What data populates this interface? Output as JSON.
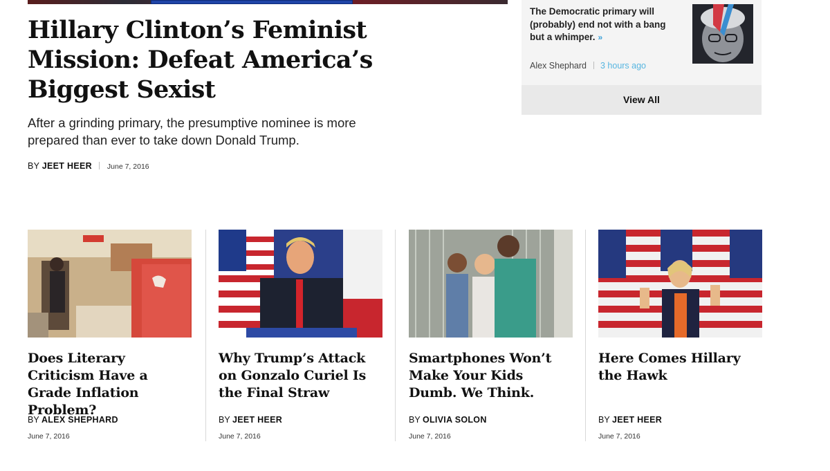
{
  "lead": {
    "headline": "Hillary Clinton’s Feminist Mission: Defeat America’s Biggest Sexist",
    "dek": "After a grinding primary, the presumptive nominee is more prepared than ever to take down Donald Trump.",
    "by": "BY",
    "author": "JEET HEER",
    "date": "June 7, 2016"
  },
  "sidebar": {
    "text": "The Democratic primary will (probably) end not with a bang but a whimper.",
    "more_icon": "»",
    "author": "Alex Shephard",
    "time": "3 hours ago",
    "view_all": "View All"
  },
  "cards": [
    {
      "title": "Does Literary Criticism Have a Grade Inflation Problem?",
      "by": "BY",
      "author": "ALEX SHEPHARD",
      "date": "June 7, 2016"
    },
    {
      "title": "Why Trump’s Attack on Gonzalo Curiel Is the Final Straw",
      "by": "BY",
      "author": "JEET HEER",
      "date": "June 7, 2016"
    },
    {
      "title": "Smartphones Won’t Make Your Kids Dumb. We Think.",
      "by": "BY",
      "author": "OLIVIA SOLON",
      "date": "June 7, 2016"
    },
    {
      "title": "Here Comes Hillary the Hawk",
      "by": "BY",
      "author": "JEET HEER",
      "date": "June 7, 2016"
    }
  ],
  "colors": {
    "link_blue": "#3aa0d8",
    "view_all_bg": "#e9e9e9",
    "sidebar_bg": "#f4f4f4"
  }
}
